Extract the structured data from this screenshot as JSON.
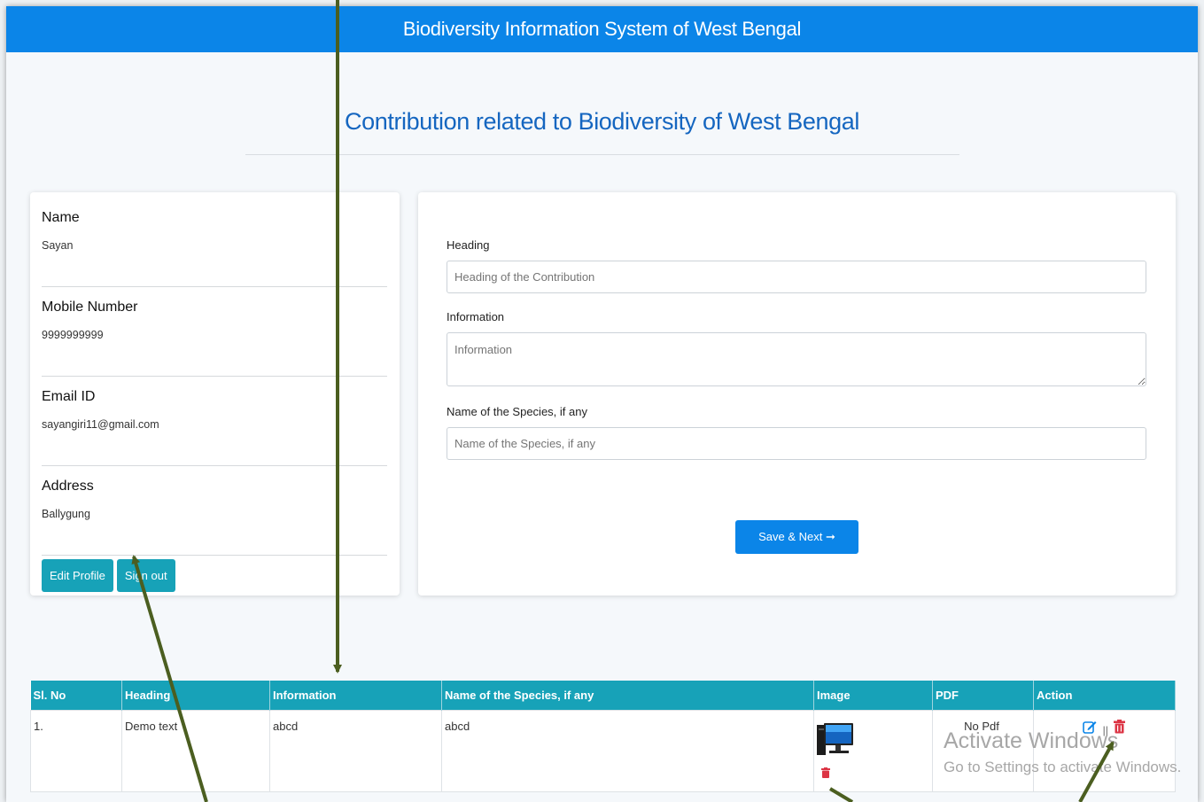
{
  "header": {
    "title": "Biodiversity Information System of West Bengal"
  },
  "page": {
    "title": "Contribution related to Biodiversity of West Bengal"
  },
  "profile": {
    "fields": [
      {
        "label": "Name",
        "value": "Sayan"
      },
      {
        "label": "Mobile Number",
        "value": "9999999999"
      },
      {
        "label": "Email ID",
        "value": "sayangiri11@gmail.com"
      },
      {
        "label": "Address",
        "value": "Ballygung"
      }
    ],
    "edit_label": "Edit Profile",
    "signout_label": "Sign out"
  },
  "form": {
    "heading_label": "Heading",
    "heading_placeholder": "Heading of the Contribution",
    "info_label": "Information",
    "info_placeholder": "Information",
    "species_label": "Name of the Species, if any",
    "species_placeholder": "Name of the Species, if any",
    "save_label": "Save & Next ➞"
  },
  "table": {
    "columns": [
      "Sl. No",
      "Heading",
      "Information",
      "Name of the Species, if any",
      "Image",
      "PDF",
      "Action"
    ],
    "rows": [
      {
        "sl": "1.",
        "heading": "Demo text",
        "information": "abcd",
        "species": "abcd",
        "image_icon": "computer-monitor-icon",
        "pdf": "No Pdf",
        "separator": "||"
      }
    ]
  },
  "watermark": {
    "line1": "Activate Windows",
    "line2": "Go to Settings to activate Windows."
  },
  "colors": {
    "primary": "#0b85e8",
    "teal": "#17a2b8",
    "danger": "#dc3545",
    "arrow": "#4b5e20"
  }
}
